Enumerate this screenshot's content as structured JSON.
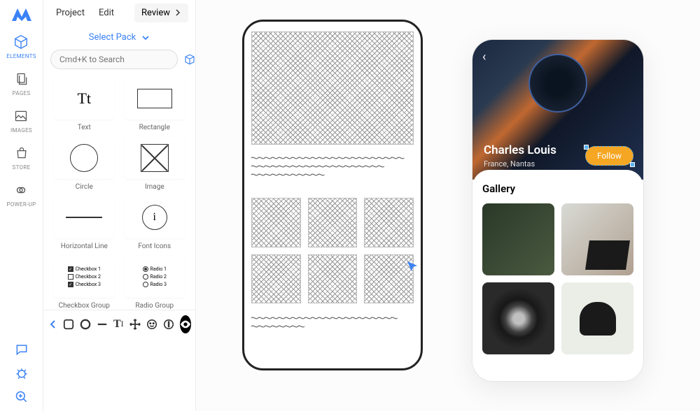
{
  "menu": {
    "project": "Project",
    "edit": "Edit",
    "review": "Review"
  },
  "rail": {
    "elements": "ELEMENTS",
    "pages": "PAGES",
    "images": "IMAGES",
    "store": "STORE",
    "powerup": "POWER-UP"
  },
  "panel": {
    "selectpack": "Select Pack",
    "searchPlaceholder": "Cmd+K to Search"
  },
  "elements": {
    "text": "Text",
    "rectangle": "Rectangle",
    "circle": "Circle",
    "image": "Image",
    "hline": "Horizontal Line",
    "ficons": "Font Icons",
    "checkbox": "Checkbox Group",
    "radio": "Radio Group",
    "cb1": "Checkbox 1",
    "cb2": "Checkbox 2",
    "cb3": "Checkbox 3",
    "r1": "Radio 1",
    "r2": "Radio 2",
    "r3": "Radio 3",
    "tt": "Tt",
    "i": "i"
  },
  "profile": {
    "name": "Charles Louis",
    "location": "France, Nantas",
    "follow": "Follow",
    "gallery": "Gallery"
  }
}
